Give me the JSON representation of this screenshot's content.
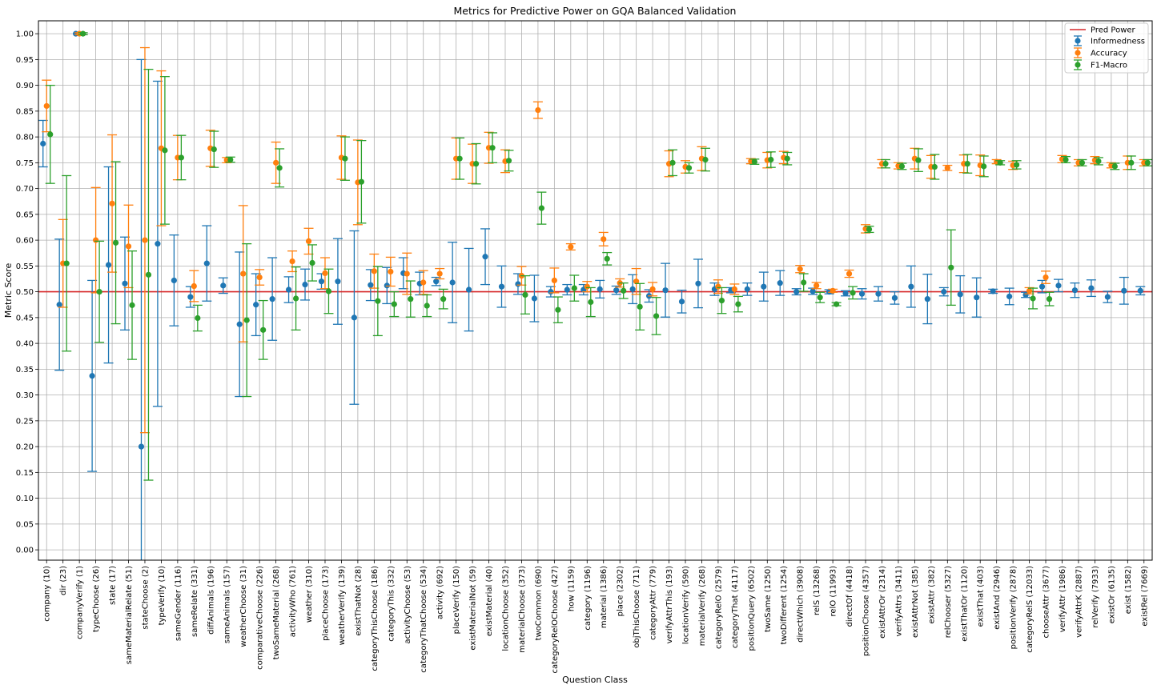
{
  "chart_data": {
    "type": "scatter",
    "title": "Metrics for Predictive Power on GQA Balanced Validation",
    "xlabel": "Question Class",
    "ylabel": "Metric Score",
    "ylim": [
      -0.02,
      1.025
    ],
    "yticks": [
      0.0,
      0.05,
      0.1,
      0.15,
      0.2,
      0.25,
      0.3,
      0.35,
      0.4,
      0.45,
      0.5,
      0.55,
      0.6,
      0.65,
      0.7,
      0.75,
      0.8,
      0.85,
      0.9,
      0.95,
      1.0
    ],
    "grid": true,
    "legend_position": "top-right",
    "reference_line": {
      "name": "Pred Power",
      "value": 0.5,
      "color": "#d62728"
    },
    "categories": [
      "company (10)",
      "dir (23)",
      "companyVerify (1)",
      "typeChoose (26)",
      "state (17)",
      "sameMaterialRelate (51)",
      "stateChoose (2)",
      "typeVerify (10)",
      "sameGender (116)",
      "sameRelate (331)",
      "diffAnimals (196)",
      "sameAnimals (157)",
      "weatherChoose (31)",
      "comparativeChoose (226)",
      "twoSameMaterial (268)",
      "activityWho (761)",
      "weather (310)",
      "placeChoose (173)",
      "weatherVerify (139)",
      "existThatNot (28)",
      "categoryThisChoose (186)",
      "categoryThis (332)",
      "activityChoose (53)",
      "categoryThatChoose (534)",
      "activity (692)",
      "placeVerify (150)",
      "existMaterialNot (59)",
      "existMaterial (40)",
      "locationChoose (352)",
      "materialChoose (373)",
      "twoCommon (690)",
      "categoryRelOChoose (427)",
      "how (1159)",
      "category (1196)",
      "material (1386)",
      "place (2302)",
      "objThisChoose (711)",
      "categoryAttr (779)",
      "verifyAttrThis (193)",
      "locationVerify (590)",
      "materialVerify (268)",
      "categoryRelO (2579)",
      "categoryThat (4117)",
      "positionQuery (6502)",
      "twoSame (1250)",
      "twoDifferent (1254)",
      "directWhich (3908)",
      "relS (13268)",
      "relO (11993)",
      "directOf (4418)",
      "positionChoose (4357)",
      "existAttrOr (2314)",
      "verifyAttrs (3411)",
      "existAttrNot (385)",
      "existAttr (382)",
      "relChooser (5327)",
      "existThatOr (1120)",
      "existThat (403)",
      "existAnd (2946)",
      "positionVerify (2878)",
      "categoryRelS (12033)",
      "chooseAttr (3677)",
      "verifyAttr (1986)",
      "verifyAttrK (2887)",
      "relVerify (7933)",
      "existOr (6135)",
      "exist (1582)",
      "existRel (7669)"
    ],
    "series": [
      {
        "name": "Informedness",
        "color": "#1f77b4",
        "values": [
          0.787,
          0.475,
          1.0,
          0.337,
          0.552,
          0.516,
          0.2,
          0.593,
          0.522,
          0.49,
          0.555,
          0.512,
          0.437,
          0.475,
          0.486,
          0.504,
          0.514,
          0.52,
          0.52,
          0.45,
          0.513,
          0.512,
          0.536,
          0.516,
          0.52,
          0.518,
          0.504,
          0.568,
          0.51,
          0.515,
          0.487,
          0.5,
          0.504,
          0.504,
          0.505,
          0.503,
          0.505,
          0.492,
          0.503,
          0.481,
          0.516,
          0.505,
          0.503,
          0.505,
          0.51,
          0.517,
          0.5,
          0.501,
          0.5,
          0.497,
          0.496,
          0.496,
          0.488,
          0.51,
          0.486,
          0.5,
          0.495,
          0.489,
          0.501,
          0.491,
          0.494,
          0.51,
          0.512,
          0.503,
          0.507,
          0.49,
          0.502,
          0.502
        ],
        "errors": [
          0.045,
          0.127,
          0.0,
          0.185,
          0.19,
          0.09,
          0.75,
          0.315,
          0.088,
          0.02,
          0.073,
          0.015,
          0.14,
          0.06,
          0.08,
          0.025,
          0.03,
          0.015,
          0.083,
          0.168,
          0.03,
          0.035,
          0.03,
          0.022,
          0.008,
          0.078,
          0.08,
          0.054,
          0.04,
          0.02,
          0.045,
          0.01,
          0.01,
          0.01,
          0.017,
          0.008,
          0.028,
          0.012,
          0.052,
          0.022,
          0.047,
          0.012,
          0.005,
          0.012,
          0.028,
          0.024,
          0.006,
          0.006,
          0.004,
          0.005,
          0.01,
          0.014,
          0.012,
          0.04,
          0.048,
          0.008,
          0.036,
          0.038,
          0.004,
          0.016,
          0.005,
          0.012,
          0.012,
          0.014,
          0.016,
          0.011,
          0.026,
          0.008
        ]
      },
      {
        "name": "Accuracy",
        "color": "#ff7f0e",
        "values": [
          0.86,
          0.555,
          1.0,
          0.6,
          0.671,
          0.588,
          0.6,
          0.778,
          0.76,
          0.511,
          0.778,
          0.755,
          0.535,
          0.528,
          0.75,
          0.559,
          0.598,
          0.536,
          0.76,
          0.712,
          0.54,
          0.539,
          0.535,
          0.518,
          0.535,
          0.758,
          0.748,
          0.779,
          0.753,
          0.531,
          0.852,
          0.522,
          0.587,
          0.51,
          0.602,
          0.517,
          0.52,
          0.505,
          0.748,
          0.742,
          0.758,
          0.51,
          0.505,
          0.753,
          0.755,
          0.76,
          0.544,
          0.512,
          0.502,
          0.535,
          0.622,
          0.748,
          0.744,
          0.758,
          0.742,
          0.74,
          0.748,
          0.745,
          0.752,
          0.745,
          0.502,
          0.528,
          0.757,
          0.75,
          0.755,
          0.745,
          0.75,
          0.75
        ],
        "errors": [
          0.05,
          0.085,
          0.002,
          0.102,
          0.133,
          0.08,
          0.373,
          0.15,
          0.043,
          0.03,
          0.035,
          0.005,
          0.132,
          0.015,
          0.04,
          0.02,
          0.025,
          0.03,
          0.042,
          0.082,
          0.033,
          0.028,
          0.04,
          0.023,
          0.01,
          0.04,
          0.038,
          0.03,
          0.022,
          0.018,
          0.016,
          0.024,
          0.006,
          0.01,
          0.013,
          0.008,
          0.025,
          0.013,
          0.025,
          0.012,
          0.023,
          0.013,
          0.01,
          0.005,
          0.015,
          0.012,
          0.007,
          0.006,
          0.003,
          0.007,
          0.008,
          0.008,
          0.006,
          0.02,
          0.022,
          0.005,
          0.017,
          0.02,
          0.004,
          0.008,
          0.006,
          0.012,
          0.007,
          0.006,
          0.007,
          0.005,
          0.013,
          0.006
        ]
      },
      {
        "name": "F1-Macro",
        "color": "#2ca02c",
        "values": [
          0.805,
          0.555,
          1.0,
          0.5,
          0.595,
          0.474,
          0.533,
          0.774,
          0.76,
          0.449,
          0.776,
          0.756,
          0.445,
          0.426,
          0.74,
          0.487,
          0.556,
          0.501,
          0.758,
          0.713,
          0.482,
          0.476,
          0.486,
          0.473,
          0.486,
          0.758,
          0.748,
          0.779,
          0.754,
          0.494,
          0.662,
          0.465,
          0.507,
          0.48,
          0.564,
          0.502,
          0.471,
          0.453,
          0.75,
          0.74,
          0.756,
          0.483,
          0.476,
          0.752,
          0.756,
          0.758,
          0.518,
          0.489,
          0.476,
          0.498,
          0.621,
          0.748,
          0.743,
          0.755,
          0.742,
          0.547,
          0.748,
          0.743,
          0.75,
          0.746,
          0.487,
          0.486,
          0.756,
          0.75,
          0.753,
          0.743,
          0.75,
          0.75
        ],
        "errors": [
          0.095,
          0.17,
          0.002,
          0.098,
          0.157,
          0.105,
          0.398,
          0.143,
          0.043,
          0.025,
          0.035,
          0.005,
          0.148,
          0.057,
          0.037,
          0.061,
          0.035,
          0.043,
          0.042,
          0.08,
          0.067,
          0.024,
          0.035,
          0.021,
          0.019,
          0.04,
          0.039,
          0.029,
          0.02,
          0.037,
          0.031,
          0.025,
          0.025,
          0.028,
          0.012,
          0.015,
          0.045,
          0.036,
          0.025,
          0.01,
          0.022,
          0.025,
          0.015,
          0.005,
          0.015,
          0.012,
          0.017,
          0.01,
          0.003,
          0.012,
          0.006,
          0.008,
          0.006,
          0.022,
          0.024,
          0.073,
          0.018,
          0.02,
          0.004,
          0.008,
          0.02,
          0.013,
          0.006,
          0.006,
          0.007,
          0.006,
          0.013,
          0.006
        ]
      }
    ],
    "legend": [
      "Pred Power",
      "Informedness",
      "Accuracy",
      "F1-Macro"
    ]
  }
}
